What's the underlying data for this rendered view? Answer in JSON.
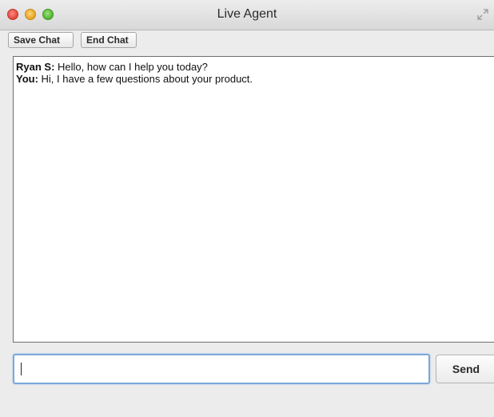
{
  "window": {
    "title": "Live Agent"
  },
  "toolbar": {
    "save_label": "Save Chat",
    "end_label": "End Chat"
  },
  "transcript": {
    "messages": [
      {
        "sender": "Ryan S:",
        "text": " Hello, how can I help you today?"
      },
      {
        "sender": "You:",
        "text": " Hi, I have a few questions about your product."
      }
    ]
  },
  "composer": {
    "value": "",
    "send_label": "Send"
  },
  "icons": {
    "close": "close-button-icon",
    "minimize": "minimize-button-icon",
    "zoom": "zoom-button-icon",
    "fullscreen": "fullscreen-icon"
  },
  "colors": {
    "close": "#e0443a",
    "minimize": "#e8a21f",
    "zoom": "#4fb42f",
    "input_focus": "#7aa7d9"
  }
}
